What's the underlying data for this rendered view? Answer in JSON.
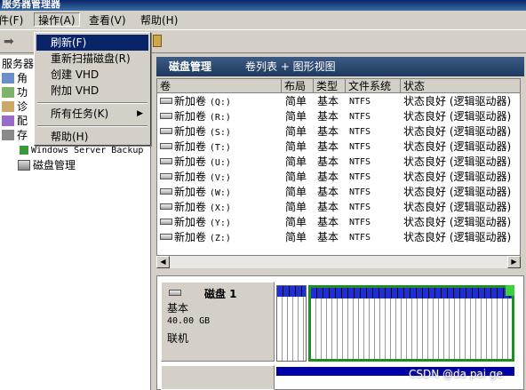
{
  "window": {
    "title": "服务器管理器"
  },
  "menubar": {
    "items": [
      {
        "label": "件(F)"
      },
      {
        "label": "操作(A)"
      },
      {
        "label": "查看(V)"
      },
      {
        "label": "帮助(H)"
      }
    ]
  },
  "dropdown": {
    "items": [
      {
        "label": "刷新(F)",
        "highlight": true
      },
      {
        "label": "重新扫描磁盘(R)"
      },
      {
        "label": "创建 VHD"
      },
      {
        "label": "附加 VHD"
      },
      {
        "label": "所有任务(K)",
        "submenu": true
      },
      {
        "label": "帮助(H)"
      }
    ]
  },
  "tree": {
    "header": "服务器",
    "items": [
      {
        "label": "角"
      },
      {
        "label": "功"
      },
      {
        "label": "诊"
      },
      {
        "label": "配"
      },
      {
        "label": "存"
      },
      {
        "label": "Windows Server Backup"
      },
      {
        "label": "磁盘管理"
      }
    ]
  },
  "panel": {
    "title": "磁盘管理",
    "subtitle": "卷列表 + 图形视图"
  },
  "table": {
    "columns": [
      "卷",
      "布局",
      "类型",
      "文件系统",
      "状态"
    ],
    "rows": [
      {
        "vol": "新加卷",
        "letter": "(Q:)",
        "layout": "简单",
        "type": "基本",
        "fs": "NTFS",
        "status": "状态良好 (逻辑驱动器)"
      },
      {
        "vol": "新加卷",
        "letter": "(R:)",
        "layout": "简单",
        "type": "基本",
        "fs": "NTFS",
        "status": "状态良好 (逻辑驱动器)"
      },
      {
        "vol": "新加卷",
        "letter": "(S:)",
        "layout": "简单",
        "type": "基本",
        "fs": "NTFS",
        "status": "状态良好 (逻辑驱动器)"
      },
      {
        "vol": "新加卷",
        "letter": "(T:)",
        "layout": "简单",
        "type": "基本",
        "fs": "NTFS",
        "status": "状态良好 (逻辑驱动器)"
      },
      {
        "vol": "新加卷",
        "letter": "(U:)",
        "layout": "简单",
        "type": "基本",
        "fs": "NTFS",
        "status": "状态良好 (逻辑驱动器)"
      },
      {
        "vol": "新加卷",
        "letter": "(V:)",
        "layout": "简单",
        "type": "基本",
        "fs": "NTFS",
        "status": "状态良好 (逻辑驱动器)"
      },
      {
        "vol": "新加卷",
        "letter": "(W:)",
        "layout": "简单",
        "type": "基本",
        "fs": "NTFS",
        "status": "状态良好 (逻辑驱动器)"
      },
      {
        "vol": "新加卷",
        "letter": "(X:)",
        "layout": "简单",
        "type": "基本",
        "fs": "NTFS",
        "status": "状态良好 (逻辑驱动器)"
      },
      {
        "vol": "新加卷",
        "letter": "(Y:)",
        "layout": "简单",
        "type": "基本",
        "fs": "NTFS",
        "status": "状态良好 (逻辑驱动器)"
      },
      {
        "vol": "新加卷",
        "letter": "(Z:)",
        "layout": "简单",
        "type": "基本",
        "fs": "NTFS",
        "status": "状态良好 (逻辑驱动器)"
      }
    ]
  },
  "disk": {
    "name": "磁盘 1",
    "kind": "基本",
    "size": "40.00 GB",
    "state": "联机"
  },
  "watermark": "CSDN @da pai ge",
  "colors": {
    "highlight": "#0a246a",
    "partition_border": "#1f8f1f",
    "partition_header": "#1e2fd6"
  }
}
